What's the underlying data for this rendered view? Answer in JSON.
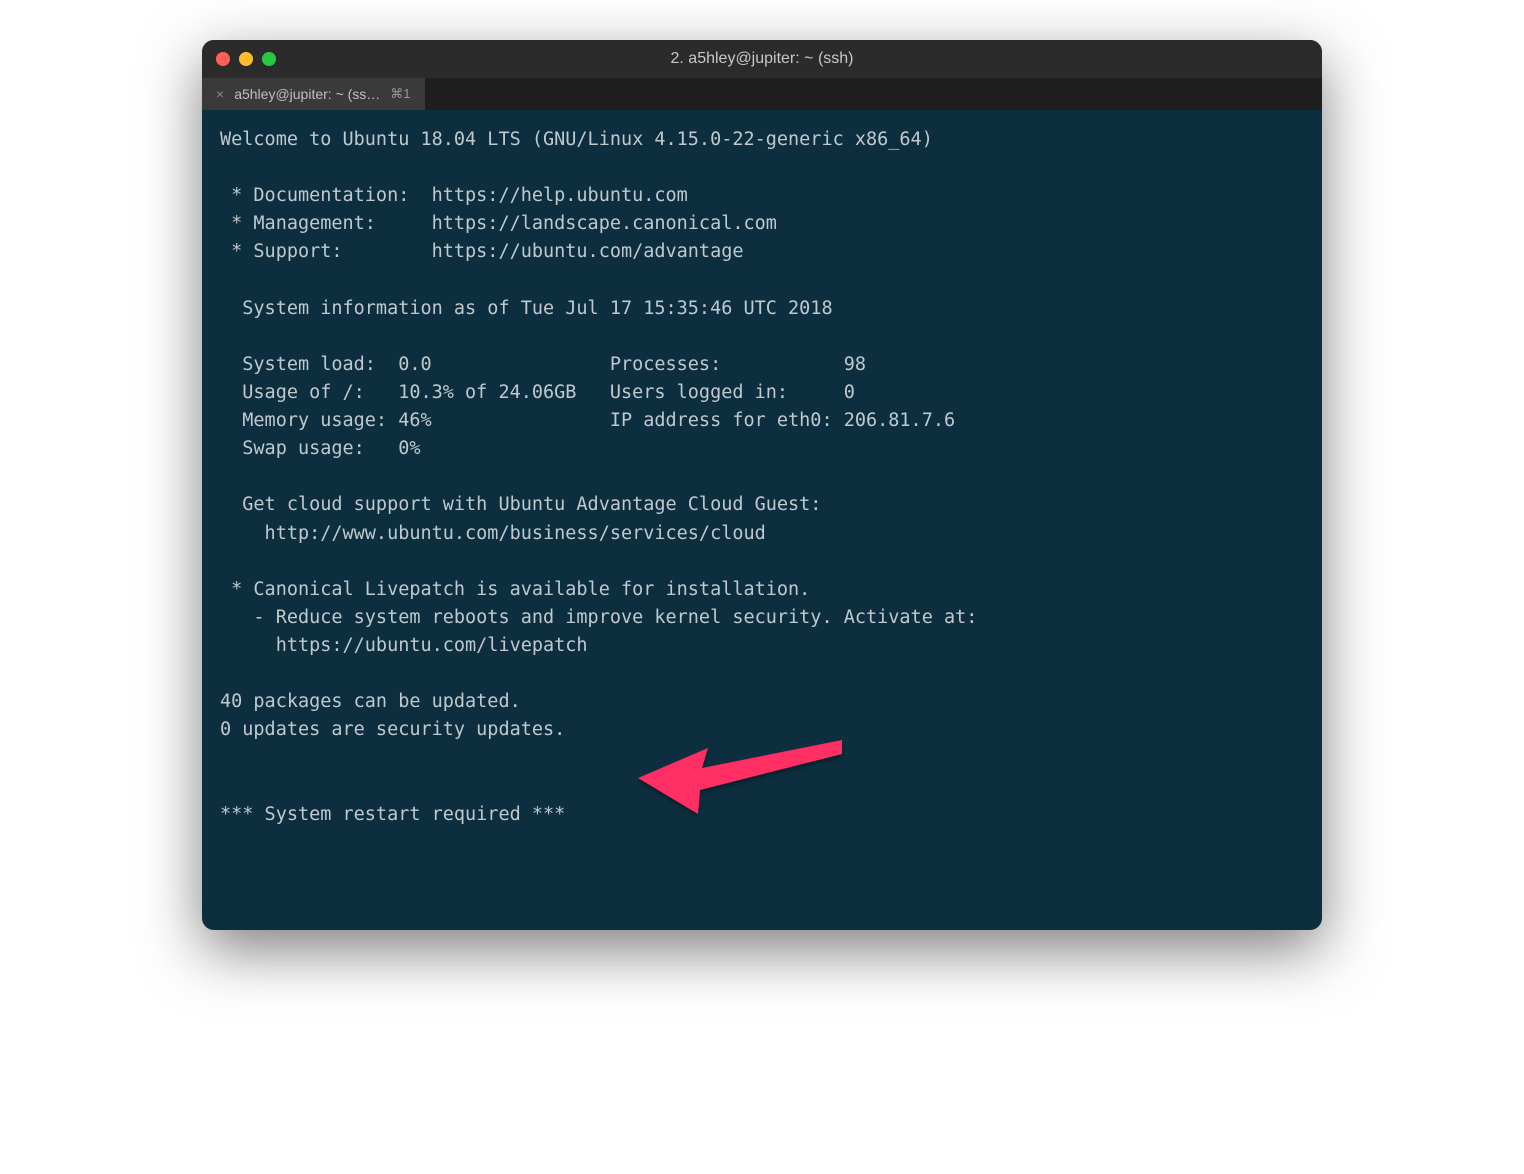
{
  "window": {
    "title": "2. a5hley@jupiter: ~ (ssh)"
  },
  "tab": {
    "label": "a5hley@jupiter: ~ (ss…",
    "shortcut": "⌘1"
  },
  "motd": {
    "welcome": "Welcome to Ubuntu 18.04 LTS (GNU/Linux 4.15.0-22-generic x86_64)",
    "links": {
      "doc_label": " * Documentation:  https://help.ubuntu.com",
      "mgmt_label": " * Management:     https://landscape.canonical.com",
      "sup_label": " * Support:        https://ubuntu.com/advantage"
    },
    "sysinfo_header": "  System information as of Tue Jul 17 15:35:46 UTC 2018",
    "sysinfo": {
      "line1": "  System load:  0.0                Processes:           98",
      "line2": "  Usage of /:   10.3% of 24.06GB   Users logged in:     0",
      "line3": "  Memory usage: 46%                IP address for eth0: 206.81.7.6",
      "line4": "  Swap usage:   0%"
    },
    "cloud1": "  Get cloud support with Ubuntu Advantage Cloud Guest:",
    "cloud2": "    http://www.ubuntu.com/business/services/cloud",
    "livepatch1": " * Canonical Livepatch is available for installation.",
    "livepatch2": "   - Reduce system reboots and improve kernel security. Activate at:",
    "livepatch3": "     https://ubuntu.com/livepatch",
    "updates1": "40 packages can be updated.",
    "updates2": "0 updates are security updates.",
    "restart": "*** System restart required ***"
  }
}
